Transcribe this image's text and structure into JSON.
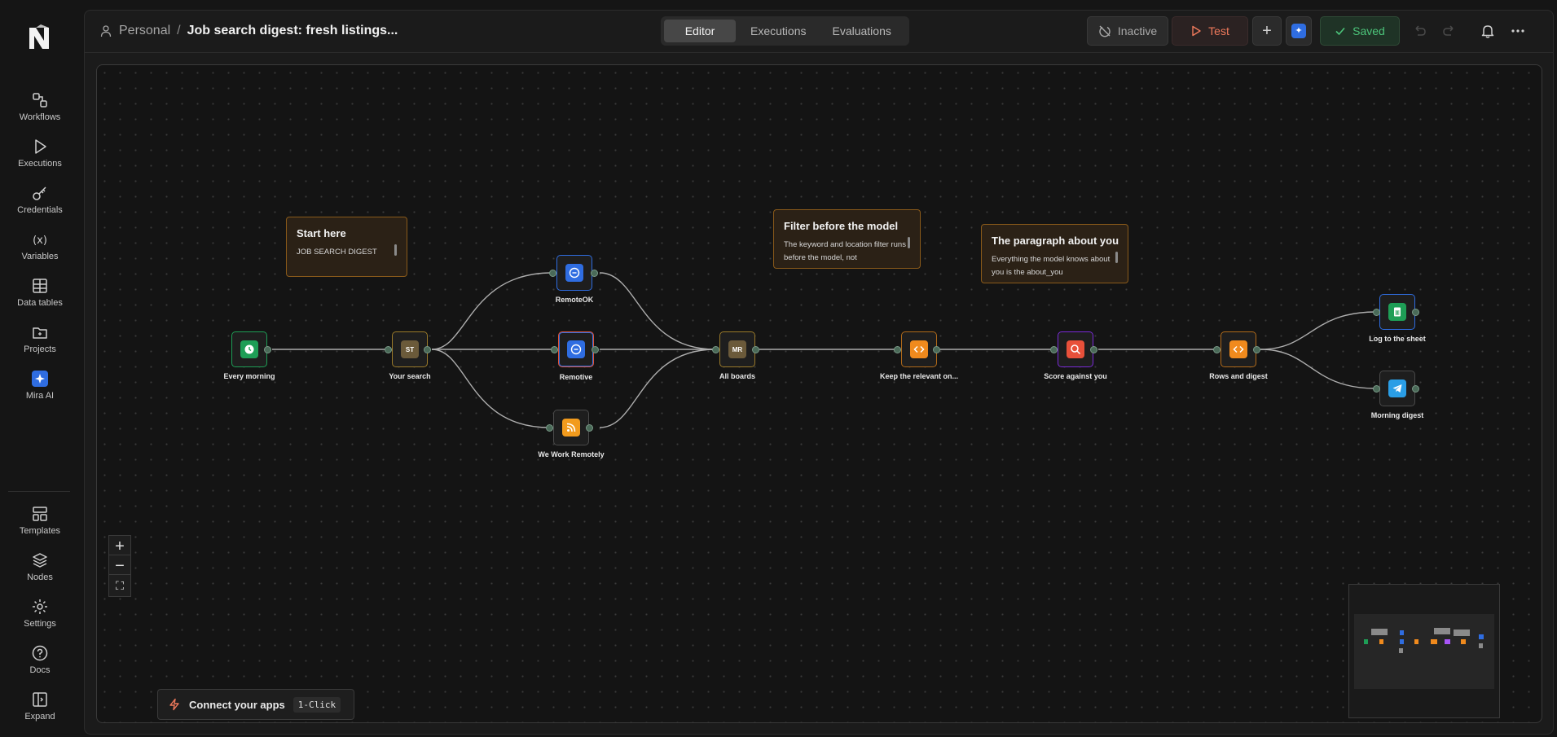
{
  "sidebar": {
    "items": [
      {
        "label": "Workflows",
        "icon": "workflows-icon"
      },
      {
        "label": "Executions",
        "icon": "play-icon"
      },
      {
        "label": "Credentials",
        "icon": "key-icon"
      },
      {
        "label": "Variables",
        "icon": "variables-icon"
      },
      {
        "label": "Data tables",
        "icon": "table-icon"
      },
      {
        "label": "Projects",
        "icon": "folder-icon"
      },
      {
        "label": "Mira AI",
        "icon": "sparkle-icon"
      }
    ],
    "bottom_items": [
      {
        "label": "Templates",
        "icon": "templates-icon"
      },
      {
        "label": "Nodes",
        "icon": "layers-icon"
      },
      {
        "label": "Settings",
        "icon": "gear-icon"
      },
      {
        "label": "Docs",
        "icon": "help-icon"
      },
      {
        "label": "Expand",
        "icon": "expand-icon"
      }
    ]
  },
  "header": {
    "breadcrumb_root": "Personal",
    "breadcrumb_sep": "/",
    "workflow_title": "Job search digest: fresh listings..."
  },
  "tabs": [
    "Editor",
    "Executions",
    "Evaluations"
  ],
  "actions": {
    "inactive": "Inactive",
    "test": "Test",
    "plus": "+",
    "saved": "Saved"
  },
  "nodes": [
    {
      "label": "Every morning",
      "badge": "",
      "color": "#1e9e56"
    },
    {
      "label": "Your search",
      "badge": "ST",
      "color": "#6b5a3a"
    },
    {
      "label": "RemoteOK",
      "badge": "",
      "color": "#2f6de1"
    },
    {
      "label": "Remotive",
      "badge": "",
      "color": "#2f6de1"
    },
    {
      "label": "We Work Remotely",
      "badge": "",
      "color": "#f29b1d"
    },
    {
      "label": "All boards",
      "badge": "MR",
      "color": "#6b5a3a"
    },
    {
      "label": "Keep the relevant on...",
      "badge": "",
      "color": "#f08a1d"
    },
    {
      "label": "Score against you",
      "badge": "",
      "color": "#e8503a"
    },
    {
      "label": "Rows and digest",
      "badge": "",
      "color": "#f08a1d"
    },
    {
      "label": "Log to the sheet",
      "badge": "",
      "color": "#1e9e56"
    },
    {
      "label": "Morning digest",
      "badge": "",
      "color": "#2a9ee6"
    }
  ],
  "notes": [
    {
      "title": "Start here",
      "body": "JOB SEARCH DIGEST"
    },
    {
      "title": "Filter before the model",
      "body": "The keyword and location filter runs before the model, not"
    },
    {
      "title": "The paragraph about you",
      "body": "Everything the model knows about you is the about_you"
    }
  ],
  "zoom": {
    "in": "+",
    "out": "−",
    "fit": "⛶"
  },
  "connect": {
    "label": "Connect your apps",
    "badge": "1-Click"
  }
}
